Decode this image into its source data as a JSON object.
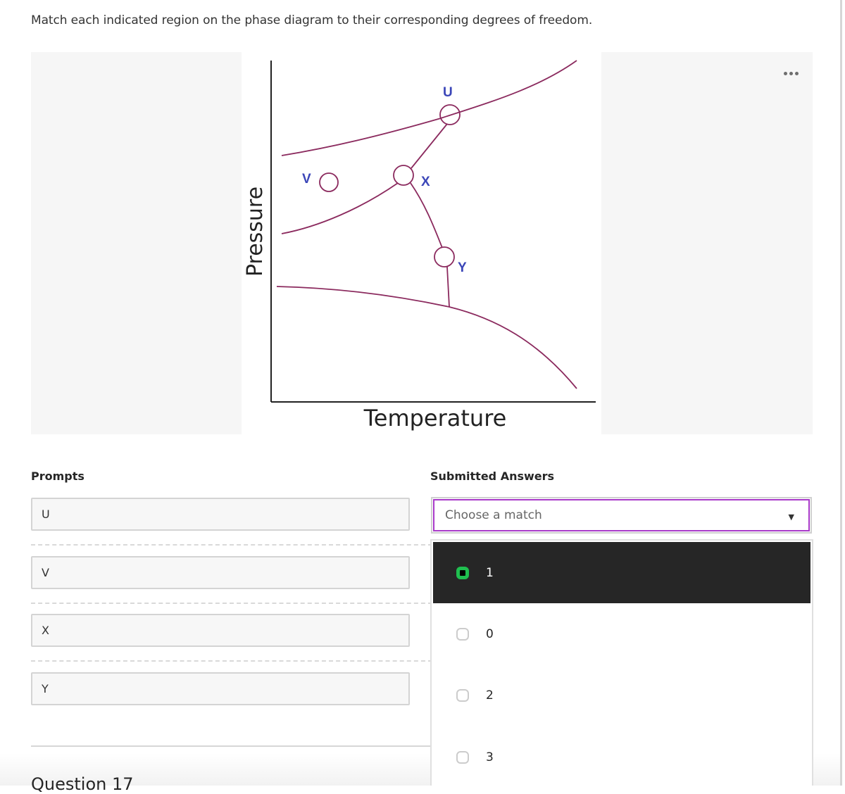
{
  "question": {
    "text": "Match each indicated region on the phase diagram to their corresponding degrees of freedom."
  },
  "diagram": {
    "x_axis_label": "Temperature",
    "y_axis_label": "Pressure",
    "point_labels": {
      "U": "U",
      "V": "V",
      "X": "X",
      "Y": "Y"
    },
    "line_color": "#8b2a5e",
    "label_color": "#3b46b8"
  },
  "image_menu": {
    "icon": "more-horizontal-icon"
  },
  "prompts": {
    "heading": "Prompts",
    "items": [
      {
        "label": "U"
      },
      {
        "label": "V"
      },
      {
        "label": "X"
      },
      {
        "label": "Y"
      }
    ]
  },
  "answers": {
    "heading": "Submitted Answers",
    "select": {
      "placeholder": "Choose a match",
      "caret": "▼",
      "focus_color": "#a93ac9"
    },
    "options": [
      {
        "label": "1",
        "highlighted": true
      },
      {
        "label": "0",
        "highlighted": false
      },
      {
        "label": "2",
        "highlighted": false
      },
      {
        "label": "3",
        "highlighted": false
      }
    ]
  },
  "next_question": {
    "label": "Question 17"
  }
}
